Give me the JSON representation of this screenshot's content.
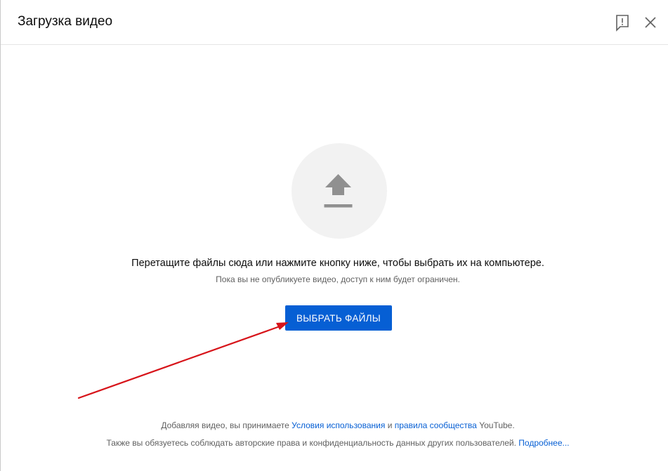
{
  "dialog": {
    "title": "Загрузка видео",
    "feedback_icon": "feedback-icon",
    "close_icon": "close-icon"
  },
  "upload": {
    "icon": "upload-arrow-icon",
    "main_text": "Перетащите файлы сюда или нажмите кнопку ниже, чтобы выбрать их на компьютере.",
    "sub_text": "Пока вы не опубликуете видео, доступ к ним будет ограничен.",
    "select_button_label": "ВЫБРАТЬ ФАЙЛЫ"
  },
  "footer": {
    "line1_prefix": "Добавляя видео, вы принимаете ",
    "terms_link": "Условия использования",
    "and_text": " и ",
    "community_link": "правила сообщества",
    "line1_suffix": " YouTube.",
    "line2_text": "Также вы обязуетесь соблюдать авторские права и конфиденциальность данных других пользователей. ",
    "learn_more_link": "Подробнее..."
  },
  "annotation": {
    "arrow_color": "#d7141a"
  },
  "colors": {
    "accent": "#065fd4",
    "circle_bg": "#f2f2f2",
    "icon_gray": "#909090"
  }
}
